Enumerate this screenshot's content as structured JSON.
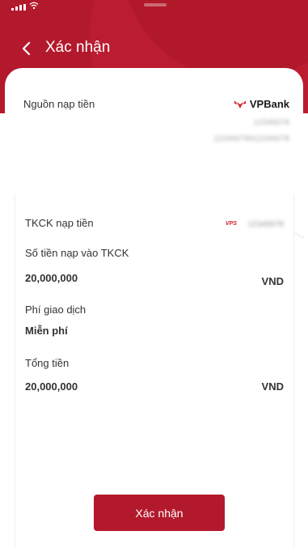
{
  "nav": {
    "title": "Xác nhận"
  },
  "source": {
    "label": "Nguồn nạp tiền",
    "bank_name": "VPBank",
    "account_name_masked": "12345678",
    "account_number_masked": "12345678912345678"
  },
  "details": {
    "account_label": "TKCK nạp tiền",
    "vps_logo_text": "VPS",
    "account_masked": "12345678",
    "amount_label": "Số tiền nạp vào TKCK",
    "amount_value": "20,000,000",
    "amount_currency": "VND",
    "fee_label": "Phí giao dịch",
    "fee_value": "Miễn phí",
    "total_label": "Tổng tiền",
    "total_value": "20,000,000",
    "total_currency": "VND"
  },
  "actions": {
    "confirm_label": "Xác nhận"
  },
  "colors": {
    "brand": "#b3192c",
    "amount": "#a8182b"
  }
}
